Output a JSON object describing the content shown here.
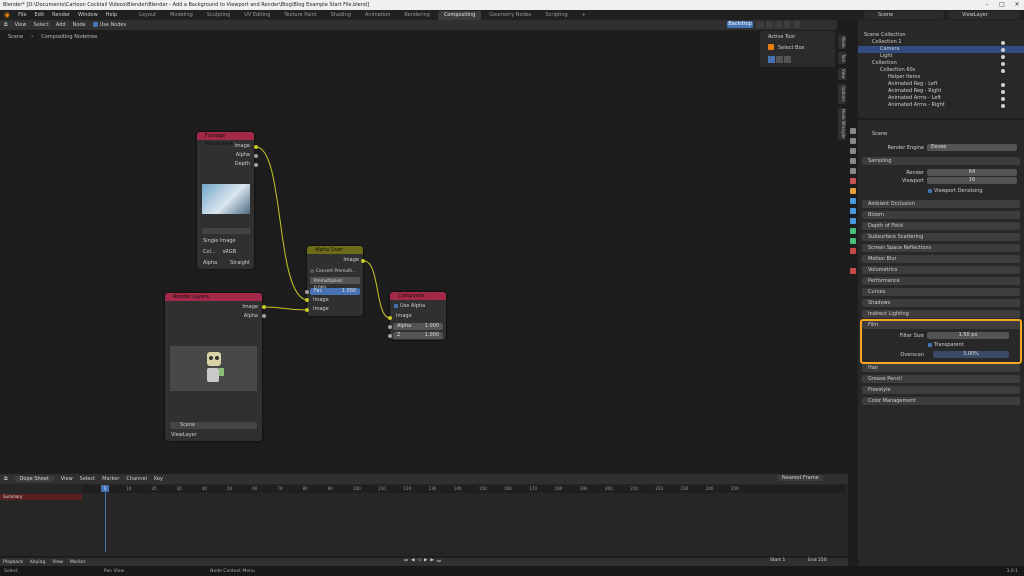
{
  "window": {
    "title": "Blender* [D:\\Documents\\Cartoon Cocktail Videos\\Blender\\Blender - Add a Background to Viewport and Render\\Blog\\Blog Example Start File.blend]",
    "controls": [
      "–",
      "□",
      "✕"
    ]
  },
  "menu": {
    "items": [
      "File",
      "Edit",
      "Render",
      "Window",
      "Help"
    ],
    "workspaces": [
      "Layout",
      "Modeling",
      "Sculpting",
      "UV Editing",
      "Texture Paint",
      "Shading",
      "Animation",
      "Rendering",
      "Compositing",
      "Geometry Nodes",
      "Scripting",
      "+"
    ],
    "active_workspace": "Compositing",
    "scene": "Scene",
    "view_layer": "ViewLayer"
  },
  "node_editor": {
    "header_items": [
      "View",
      "Select",
      "Add",
      "Node"
    ],
    "use_nodes": "Use Nodes",
    "slot": "Backdrop",
    "breadcrumb": [
      "Scene",
      "Compositing Nodetree"
    ]
  },
  "nodes": {
    "movie": {
      "title": "Footage Movie.mp4",
      "outputs": [
        "Image",
        "Alpha",
        "Depth"
      ],
      "type": "Single Image",
      "cs_label": "Col...",
      "cs_value": "sRGB",
      "alpha_label": "Alpha",
      "alpha_value": "Straight"
    },
    "render_layers": {
      "title": "Render Layers",
      "outputs": [
        "Image",
        "Alpha"
      ],
      "scene": "Scene",
      "layer": "ViewLayer"
    },
    "alpha_over": {
      "title": "Alpha Over",
      "output": "Image",
      "convert": "Convert Premulti...",
      "premul": "Premultiplied: 0.000",
      "fac_label": "Fac",
      "fac_value": "1.000",
      "inputs": [
        "Image",
        "Image"
      ]
    },
    "composite": {
      "title": "Composite",
      "use_alpha": "Use Alpha",
      "input": "Image",
      "alpha_label": "Alpha",
      "alpha_value": "1.000",
      "z_label": "Z",
      "z_value": "1.000"
    }
  },
  "node_panel": {
    "header": "Active Tool",
    "tool": "Select Box"
  },
  "sidebar_tabs": [
    "Node",
    "Tool",
    "View",
    "Options",
    "Node Wrangler"
  ],
  "outliner": {
    "rows": [
      {
        "label": "Scene Collection"
      },
      {
        "label": "Collection 1"
      },
      {
        "label": "Camera"
      },
      {
        "label": "Light"
      },
      {
        "label": "Collection"
      },
      {
        "label": "Collection 60s"
      },
      {
        "label": "Helper Items"
      },
      {
        "label": "Animated Reg - Left"
      },
      {
        "label": "Animated Reg - Right"
      },
      {
        "label": "Animated Arms - Left"
      },
      {
        "label": "Animated Arms - Right"
      }
    ]
  },
  "properties": {
    "title": "Scene",
    "render_engine_label": "Render Engine",
    "render_engine": "Eevee",
    "sampling": "Sampling",
    "render_label": "Render",
    "render_val": "64",
    "viewport_label": "Viewport",
    "viewport_val": "16",
    "viewport_denoising": "Viewport Denoising",
    "sections": [
      "Ambient Occlusion",
      "Bloom",
      "Depth of Field",
      "Subsurface Scattering",
      "Screen Space Reflections",
      "Motion Blur",
      "Volumetrics",
      "Performance",
      "Curves",
      "Shadows",
      "Indirect Lighting"
    ],
    "film": "Film",
    "filter_size_label": "Filter Size",
    "filter_size": "1.50 px",
    "transparent": "Transparent",
    "overscan_label": "Overscan",
    "overscan": "3.00%",
    "bottom_sections": [
      "Grease Pencil",
      "Freestyle",
      "Color Management"
    ],
    "bottom_first": "Hair"
  },
  "timeline": {
    "editor": "Dope Sheet",
    "menus": [
      "View",
      "Select",
      "Marker",
      "Channel",
      "Key"
    ],
    "mode": "Nearest Frame",
    "current_frame": "1",
    "ticks": [
      "1",
      "10",
      "20",
      "30",
      "40",
      "50",
      "60",
      "70",
      "80",
      "90",
      "100",
      "110",
      "120",
      "130",
      "140",
      "150",
      "160",
      "170",
      "180",
      "190",
      "200",
      "210",
      "220",
      "230",
      "240",
      "250"
    ],
    "summary": "Summary",
    "playback_menus": [
      "Playback",
      "Keying",
      "View",
      "Marker"
    ],
    "start_label": "Start",
    "start": "1",
    "end_label": "End",
    "end": "250"
  },
  "status": {
    "items": [
      "Select",
      "Pan View",
      "Node Context Menu"
    ],
    "version": "3.0.1"
  },
  "colors": {
    "accent": "#4772b3",
    "highlight": "#f5a623",
    "input_node": "#a3294a",
    "alpha_over": "#6b6b1a",
    "link": "#c7c729"
  }
}
